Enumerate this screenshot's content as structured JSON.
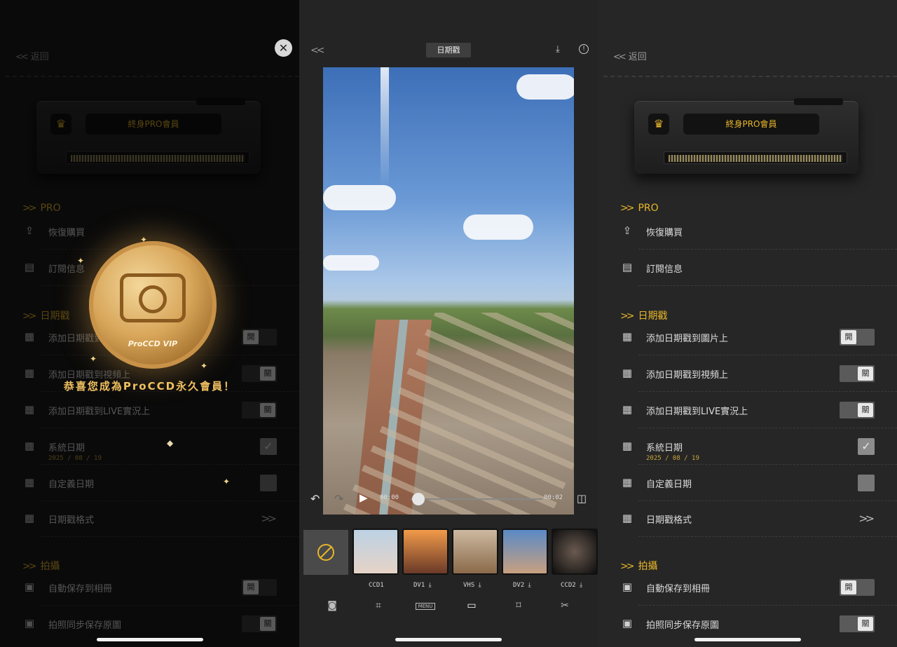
{
  "settings": {
    "back_label": "返回",
    "membership_label": "終身PRO會員",
    "sections": {
      "pro": "PRO",
      "datestamp": "日期戳",
      "shoot": "拍攝"
    },
    "rows": {
      "restore": "恢復購買",
      "subscription": "訂閱信息",
      "add_to_photo": "添加日期戳到圖片上",
      "add_to_video": "添加日期戳到視頻上",
      "add_to_live": "添加日期戳到LIVE實況上",
      "system_date": "系統日期",
      "system_date_value": "2025 / 08 / 19",
      "custom_date": "自定義日期",
      "format": "日期戳格式",
      "autosave": "自動保存到相冊",
      "sync_note": "拍照同步保存原圖"
    },
    "toggles": {
      "add_to_photo": "開",
      "add_to_video": "關",
      "add_to_live": "關",
      "autosave": "開",
      "sync": "關"
    }
  },
  "overlay": {
    "coin_text": "ProCCD VIP",
    "congrats": "恭喜您成為ProCCD永久會員！"
  },
  "editor": {
    "title": "日期戳",
    "time_start": "00:00",
    "time_end": "00:02",
    "progress": 0.06,
    "filters": [
      {
        "name": "CCD1",
        "download": false
      },
      {
        "name": "DV1",
        "download": true
      },
      {
        "name": "VHS",
        "download": true
      },
      {
        "name": "DV2",
        "download": true
      },
      {
        "name": "CCD2",
        "download": true
      }
    ],
    "filter_labels": {
      "f0": "CCD1",
      "f1": "DV1 ⤓",
      "f2": "VHS ⤓",
      "f3": "DV2 ⤓",
      "f4": "CCD2 ⤓"
    },
    "tool_menu_label": "MENU"
  },
  "colors": {
    "accent": "#e8b62a"
  }
}
